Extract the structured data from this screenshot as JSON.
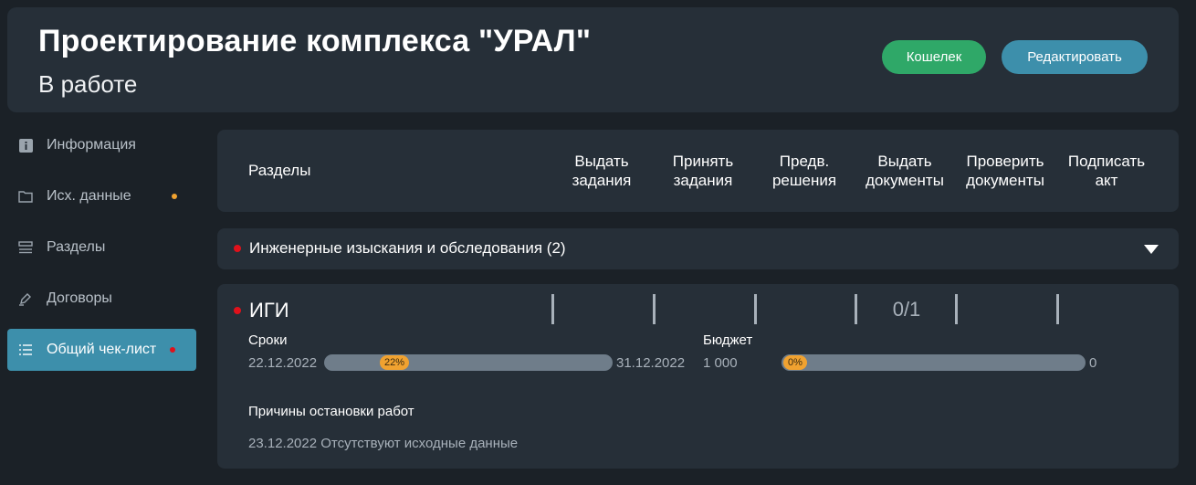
{
  "header": {
    "title": "Проектирование комплекса \"УРАЛ\"",
    "status": "В работе",
    "wallet_label": "Кошелек",
    "edit_label": "Редактировать"
  },
  "sidebar": {
    "items": [
      {
        "label": "Информация",
        "icon": "info-icon"
      },
      {
        "label": "Исх. данные",
        "icon": "folder-icon",
        "dot_color": "#f0a230"
      },
      {
        "label": "Разделы",
        "icon": "sections-icon"
      },
      {
        "label": "Договоры",
        "icon": "pen-icon"
      },
      {
        "label": "Общий чек-лист",
        "icon": "checklist-icon",
        "dot_color": "#e0111b",
        "active": true
      }
    ]
  },
  "table": {
    "sections_label": "Разделы",
    "columns": [
      {
        "line1": "Выдать",
        "line2": "задания"
      },
      {
        "line1": "Принять",
        "line2": "задания"
      },
      {
        "line1": "Предв.",
        "line2": "решения"
      },
      {
        "line1": "Выдать",
        "line2": "документы"
      },
      {
        "line1": "Проверить",
        "line2": "документы"
      },
      {
        "line1": "Подписать",
        "line2": "акт"
      }
    ]
  },
  "group": {
    "title": "Инженерные изыскания и обследования (2)",
    "status_color": "#e0111b",
    "icon": "chevron-down-icon"
  },
  "item": {
    "title": "ИГИ",
    "column_values": [
      "",
      "",
      "",
      "0/1",
      "",
      ""
    ],
    "terms": {
      "label": "Сроки",
      "start": "22.12.2022",
      "end": "31.12.2022",
      "progress_label": "22%",
      "progress": 22
    },
    "budget": {
      "label": "Бюджет",
      "value": "1 000",
      "remaining": "0",
      "progress_label": "0%",
      "progress": 0
    },
    "stop_reasons": {
      "label": "Причины остановки работ",
      "entry": "23.12.2022 Отсутствуют исходные данные"
    }
  }
}
